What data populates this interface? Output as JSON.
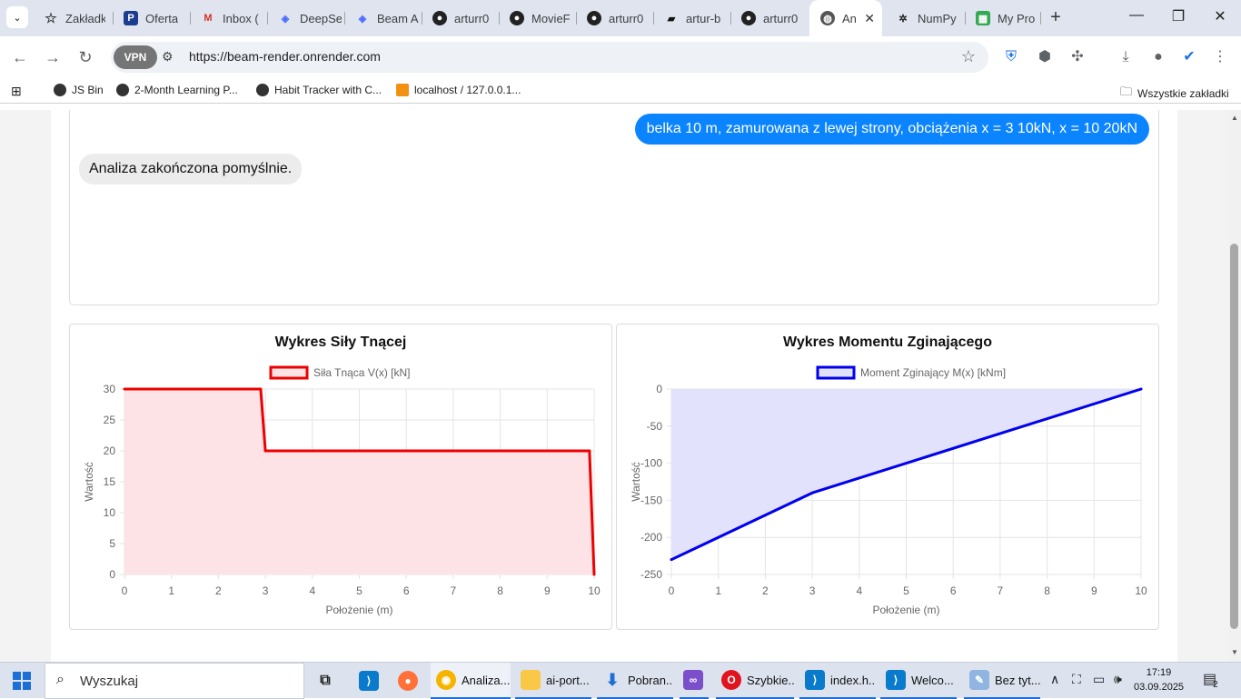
{
  "browser": {
    "tabs": [
      {
        "label": "Zakładk",
        "icon": "star-icon"
      },
      {
        "label": "Oferta",
        "icon": "p-logo-icon"
      },
      {
        "label": "Inbox (",
        "icon": "gmail-icon"
      },
      {
        "label": "DeepSe",
        "icon": "deepseek-icon"
      },
      {
        "label": "Beam A",
        "icon": "deepseek-icon"
      },
      {
        "label": "arturr0",
        "icon": "github-icon"
      },
      {
        "label": "MovieF",
        "icon": "github-icon"
      },
      {
        "label": "arturr0",
        "icon": "github-icon"
      },
      {
        "label": "artur-b",
        "icon": "render-icon"
      },
      {
        "label": "arturr0",
        "icon": "github-icon"
      },
      {
        "label": "An",
        "icon": "globe-icon"
      },
      {
        "label": "NumPy",
        "icon": "openai-icon"
      },
      {
        "label": "My Pro",
        "icon": "sheet-icon"
      }
    ],
    "url": "https://beam-render.onrender.com",
    "vpn_label": "VPN",
    "bookmarks": [
      {
        "label": "JS Bin"
      },
      {
        "label": "2-Month Learning P..."
      },
      {
        "label": "Habit Tracker with C..."
      },
      {
        "label": "localhost / 127.0.0.1..."
      }
    ],
    "all_bookmarks": "Wszystkie zakładki"
  },
  "chat": {
    "user_message": "belka 10 m, zamurowana z lewej strony, obciążenia x = 3 10kN, x = 10 20kN",
    "bot_message": "Analiza zakończona pomyślnie."
  },
  "chart_data": [
    {
      "type": "line",
      "title": "Wykres Siły Tnącej",
      "legend": "Siła Tnąca V(x) [kN]",
      "xlabel": "Położenie (m)",
      "ylabel": "Wartość",
      "x": [
        0,
        2.9,
        3.0,
        9.9,
        10.0
      ],
      "y": [
        30,
        30,
        20,
        20,
        0
      ],
      "xlim": [
        0,
        10
      ],
      "ylim": [
        0,
        30
      ],
      "xticks": [
        "0",
        "1",
        "2",
        "3",
        "4",
        "5",
        "6",
        "7",
        "8",
        "9",
        "10"
      ],
      "yticks": [
        "30",
        "25",
        "20",
        "15",
        "10",
        "5",
        "0"
      ],
      "color": "#ee0000",
      "fill": "#fde3e5",
      "grid": true,
      "legend_position": "top"
    },
    {
      "type": "line",
      "title": "Wykres Momentu Zginającego",
      "legend": "Moment Zginający M(x) [kNm]",
      "xlabel": "Położenie (m)",
      "ylabel": "Wartość",
      "x": [
        0,
        3,
        10
      ],
      "y": [
        -230,
        -140,
        0
      ],
      "xlim": [
        0,
        10
      ],
      "ylim": [
        -250,
        0
      ],
      "xticks": [
        "0",
        "1",
        "2",
        "3",
        "4",
        "5",
        "6",
        "7",
        "8",
        "9",
        "10"
      ],
      "yticks": [
        "0",
        "-50",
        "-100",
        "-150",
        "-200",
        "-250"
      ],
      "color": "#0000ee",
      "fill": "#e2e2fc",
      "grid": true,
      "legend_position": "top"
    }
  ],
  "taskbar": {
    "search_placeholder": "Wyszukaj",
    "apps": [
      {
        "label": "",
        "icon": "task-view-icon"
      },
      {
        "label": "",
        "icon": "vscode-icon"
      },
      {
        "label": "",
        "icon": "firefox-icon"
      },
      {
        "label": "Analiza...",
        "icon": "chrome-icon"
      },
      {
        "label": "ai-port...",
        "icon": "folder-icon"
      },
      {
        "label": "Pobran...",
        "icon": "download-icon"
      },
      {
        "label": "",
        "icon": "visual-studio-icon"
      },
      {
        "label": "Szybkie...",
        "icon": "opera-icon"
      },
      {
        "label": "index.h...",
        "icon": "vscode-icon"
      },
      {
        "label": "Welco...",
        "icon": "vscode-icon"
      },
      {
        "label": "Bez tyt...",
        "icon": "paint-icon"
      }
    ],
    "time": "17:19",
    "date": "03.09.2025",
    "notifications": "2"
  }
}
